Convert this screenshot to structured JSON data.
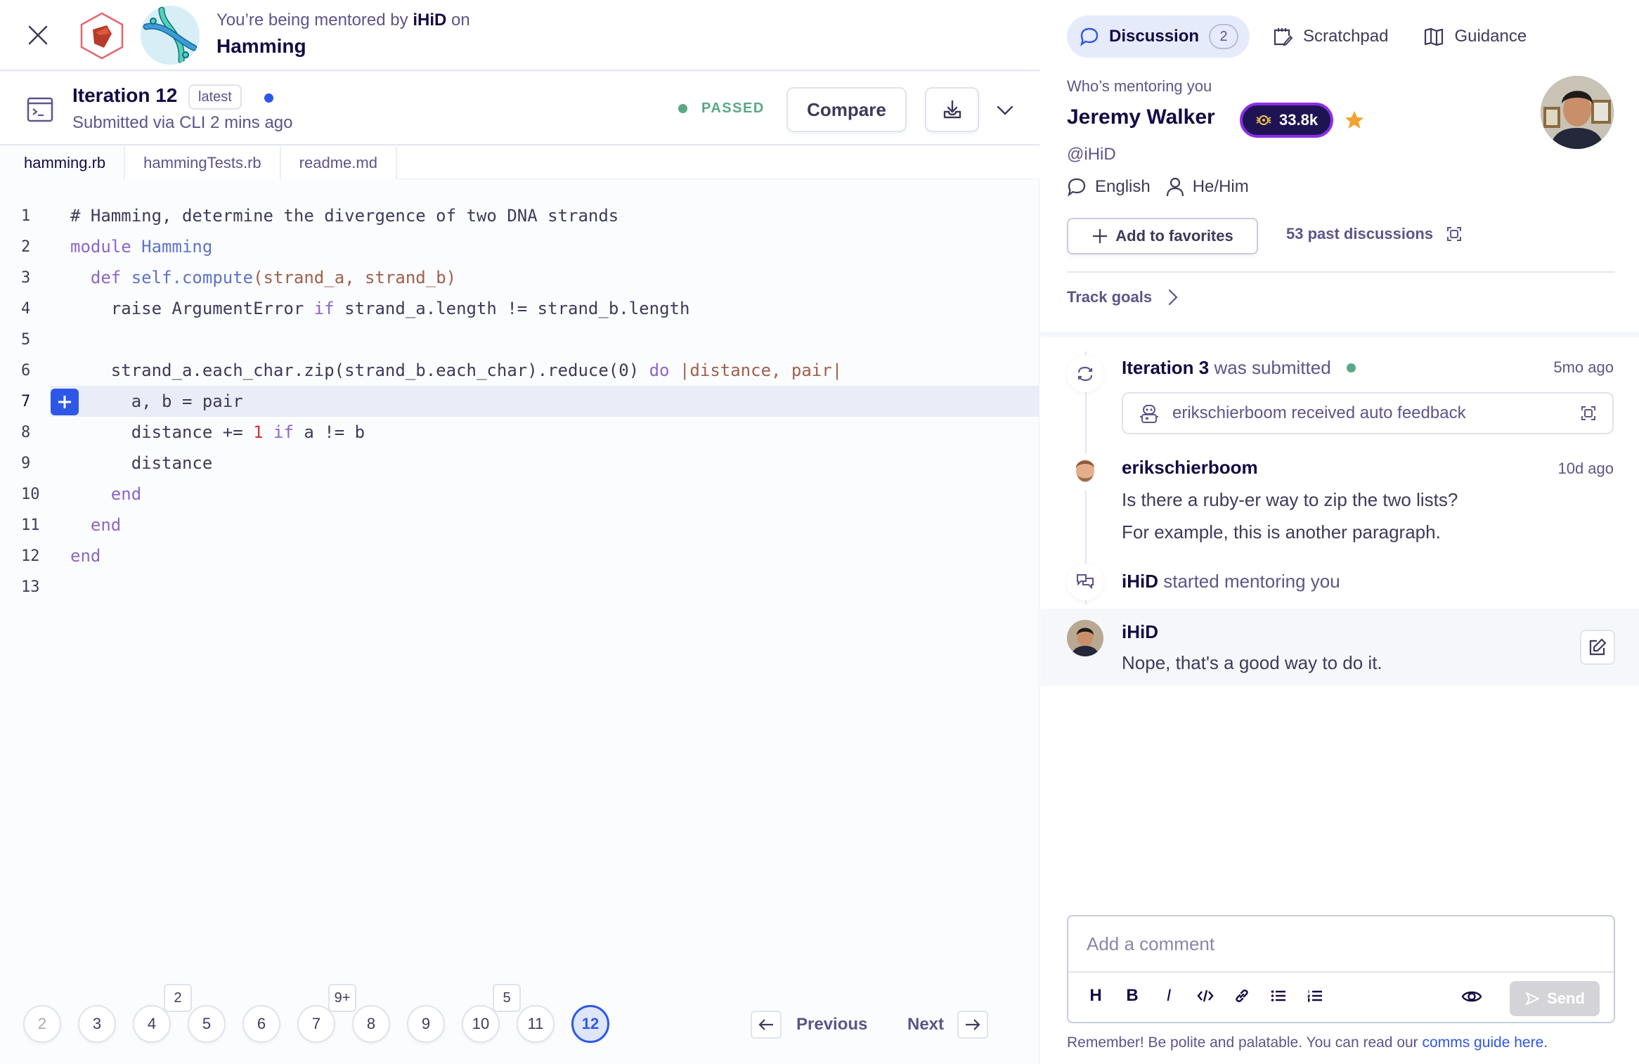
{
  "header": {
    "mentored_prefix": "You’re being mentored by",
    "mentor_handle": "iHiD",
    "mentored_suffix": "on",
    "exercise_title": "Hamming",
    "track_icon": "ruby-icon",
    "exercise_icon": "dna-icon"
  },
  "iteration": {
    "title": "Iteration 12",
    "badge": "latest",
    "subtitle": "Submitted via CLI 2 mins ago",
    "status": "PASSED",
    "compare_label": "Compare",
    "colors": {
      "accent": "#2E57E8",
      "passed": "#59A886"
    }
  },
  "files": {
    "tabs": [
      {
        "label": "hamming.rb",
        "active": true
      },
      {
        "label": "hammingTests.rb",
        "active": false
      },
      {
        "label": "readme.md",
        "active": false
      }
    ]
  },
  "code": {
    "highlighted_line": 7,
    "lines": [
      {
        "n": "1",
        "tokens": [
          [
            "cm",
            "# Hamming, determine the divergence of two DNA strands"
          ]
        ]
      },
      {
        "n": "2",
        "tokens": [
          [
            "kw",
            "module"
          ],
          [
            "",
            " "
          ],
          [
            "cls",
            "Hamming"
          ]
        ]
      },
      {
        "n": "3",
        "tokens": [
          [
            "",
            "  "
          ],
          [
            "kw",
            "def"
          ],
          [
            "",
            " "
          ],
          [
            "cls",
            "self.compute"
          ],
          [
            "arg",
            "(strand_a, strand_b)"
          ]
        ]
      },
      {
        "n": "4",
        "tokens": [
          [
            "",
            "    raise ArgumentError "
          ],
          [
            "kw",
            "if"
          ],
          [
            "",
            " strand_a.length != strand_b.length"
          ]
        ]
      },
      {
        "n": "5",
        "tokens": []
      },
      {
        "n": "6",
        "tokens": [
          [
            "",
            "    strand_a.each_char.zip(strand_b.each_char).reduce(0) "
          ],
          [
            "kw",
            "do"
          ],
          [
            "",
            " "
          ],
          [
            "arg",
            "|distance, pair|"
          ]
        ]
      },
      {
        "n": "7",
        "tokens": [
          [
            "",
            "      a, b = pair"
          ]
        ]
      },
      {
        "n": "8",
        "tokens": [
          [
            "",
            "      distance += "
          ],
          [
            "num",
            "1"
          ],
          [
            "",
            " "
          ],
          [
            "kw",
            "if"
          ],
          [
            "",
            " a != b"
          ]
        ]
      },
      {
        "n": "9",
        "tokens": [
          [
            "",
            "      distance"
          ]
        ]
      },
      {
        "n": "10",
        "tokens": [
          [
            "",
            "    "
          ],
          [
            "kw",
            "end"
          ]
        ]
      },
      {
        "n": "11",
        "tokens": [
          [
            "",
            "  "
          ],
          [
            "kw",
            "end"
          ]
        ]
      },
      {
        "n": "12",
        "tokens": [
          [
            "kw",
            "end"
          ]
        ]
      },
      {
        "n": "13",
        "tokens": []
      }
    ]
  },
  "pagination": {
    "items": [
      {
        "label": "2",
        "faded": true
      },
      {
        "label": "3"
      },
      {
        "label": "4",
        "count": "2"
      },
      {
        "label": "5"
      },
      {
        "label": "6"
      },
      {
        "label": "7",
        "count": "9+"
      },
      {
        "label": "8"
      },
      {
        "label": "9"
      },
      {
        "label": "10",
        "count": "5"
      },
      {
        "label": "11"
      },
      {
        "label": "12",
        "active": true
      }
    ],
    "previous_label": "Previous",
    "next_label": "Next"
  },
  "panel": {
    "tabs": [
      {
        "label": "Discussion",
        "count": "2",
        "active": true,
        "icon": "chat-bubble-icon"
      },
      {
        "label": "Scratchpad",
        "icon": "scratchpad-icon"
      },
      {
        "label": "Guidance",
        "icon": "map-icon"
      }
    ],
    "mentor": {
      "label": "Who’s mentoring you",
      "name": "Jeremy Walker",
      "reputation": "33.8k",
      "handle": "@iHiD",
      "language": "English",
      "pronouns": "He/Him",
      "favorite_label": "Add to favorites",
      "past_discussions": "53 past discussions",
      "track_goals": "Track goals"
    },
    "timeline": {
      "iteration_event": {
        "title": "Iteration 3",
        "text": "was submitted",
        "time": "5mo ago"
      },
      "auto_feedback": "erikschierboom received auto feedback",
      "student_post": {
        "author": "erikschierboom",
        "time": "10d ago",
        "paragraphs": [
          "Is there a ruby-er way to zip the two lists?",
          "For example, this is another paragraph."
        ]
      },
      "started": {
        "who": "iHiD",
        "text": "started mentoring you"
      },
      "mentor_post": {
        "author": "iHiD",
        "text": "Nope, that's a good way to do it."
      }
    },
    "composer": {
      "placeholder": "Add a comment",
      "value": "",
      "toolbar": [
        "heading",
        "bold",
        "italic",
        "code",
        "link",
        "bullet-list",
        "ordered-list"
      ],
      "send_label": "Send",
      "remember_text": "Remember! Be polite and palatable. You can read our",
      "guide_link": "comms guide here."
    }
  }
}
